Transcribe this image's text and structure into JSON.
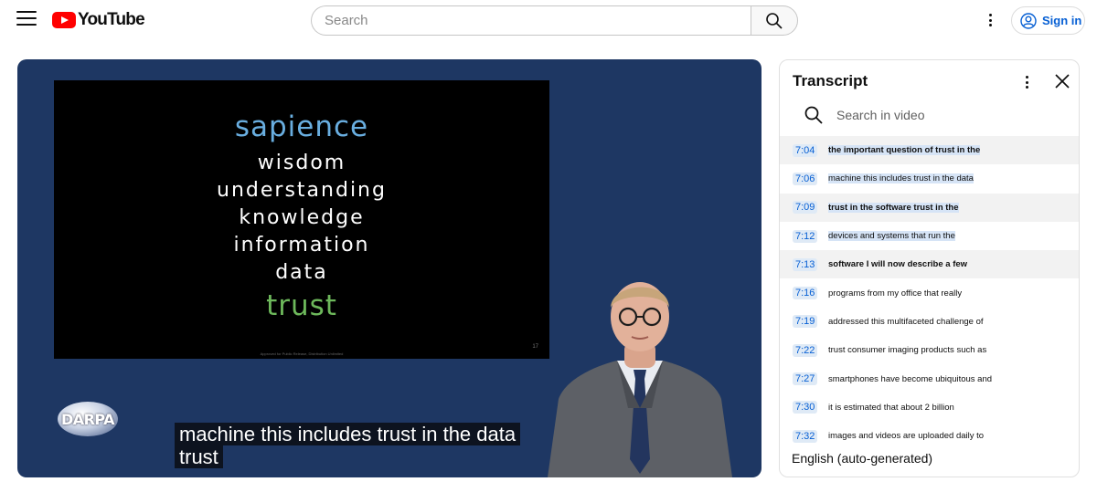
{
  "header": {
    "logo_text": "YouTube",
    "search_placeholder": "Search",
    "signin_label": "Sign in"
  },
  "player": {
    "slide_lines": [
      "sapience",
      "wisdom",
      "understanding",
      "knowledge",
      "information",
      "data",
      "trust"
    ],
    "slide_footer": "Approved for Public Release, Distribution Unlimited",
    "slide_number": "17",
    "logo_text": "DARPA",
    "caption_lines": [
      "machine this includes trust in the data",
      "trust"
    ]
  },
  "transcript": {
    "title": "Transcript",
    "search_placeholder": "Search in video",
    "language": "English (auto-generated)",
    "rows": [
      {
        "time": "7:04",
        "text": "the important question of trust in the",
        "active": true
      },
      {
        "time": "7:06",
        "text": "machine this includes trust in the data",
        "active": false
      },
      {
        "time": "7:09",
        "text": "trust in the software trust in the",
        "active": true
      },
      {
        "time": "7:12",
        "text": "devices and systems that run the",
        "active": false
      },
      {
        "time": "7:13",
        "text": "software I will now describe a few",
        "active": true
      },
      {
        "time": "7:16",
        "text": "programs from my office that really",
        "active": false
      },
      {
        "time": "7:19",
        "text": "addressed this multifaceted challenge of",
        "active": false
      },
      {
        "time": "7:22",
        "text": "trust consumer imaging products such as",
        "active": false
      },
      {
        "time": "7:27",
        "text": "smartphones have become ubiquitous and",
        "active": false
      },
      {
        "time": "7:30",
        "text": "it is estimated that about 2 billion",
        "active": false
      },
      {
        "time": "7:32",
        "text": "images and videos are uploaded daily to",
        "active": false
      }
    ]
  },
  "icons": {
    "menu": "menu-icon",
    "search": "search-icon",
    "more": "more-vert-icon",
    "account": "account-circle-icon",
    "close": "close-icon"
  },
  "colors": {
    "brand_red": "#ff0000",
    "link_blue": "#065fd4",
    "player_bg": "#1e3763",
    "slide_blue": "#69aee0",
    "slide_green": "#6db85b"
  }
}
